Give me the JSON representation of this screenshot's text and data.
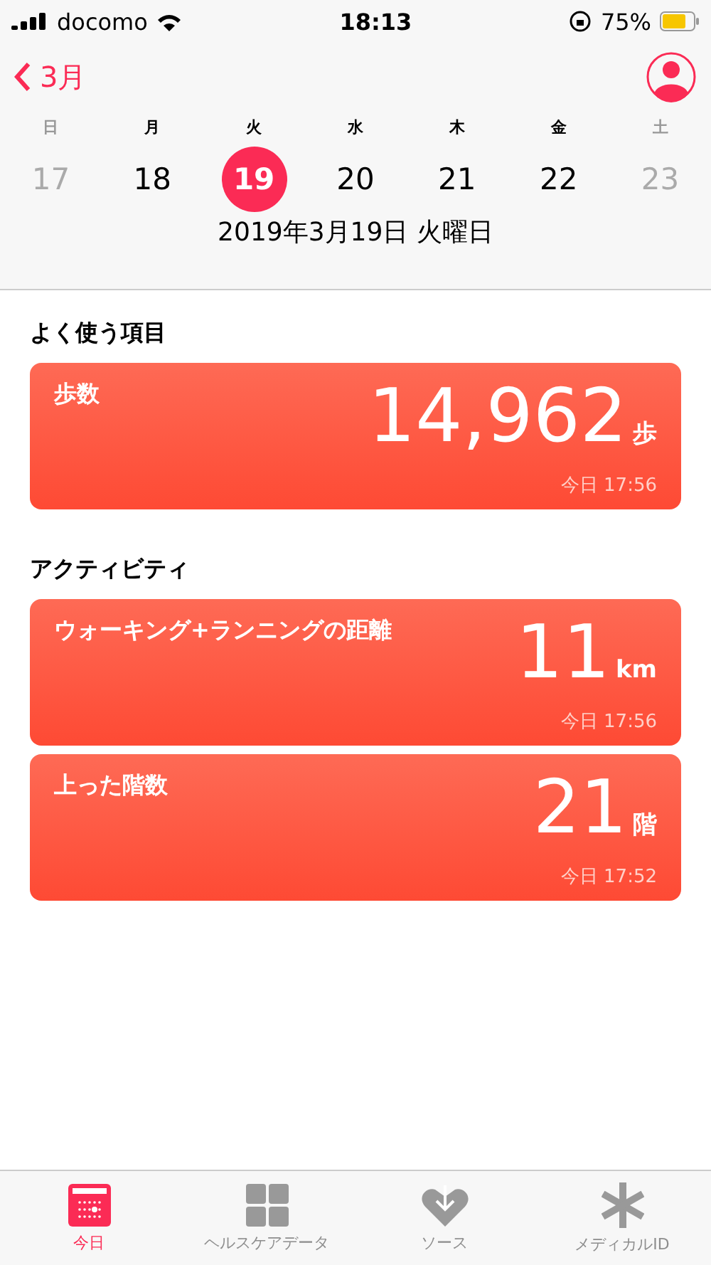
{
  "status_bar": {
    "carrier": "docomo",
    "time": "18:13",
    "battery": "75%"
  },
  "nav": {
    "back": "3月"
  },
  "week": [
    {
      "weekday": "日",
      "date": "17",
      "muted": true,
      "selected": false
    },
    {
      "weekday": "月",
      "date": "18",
      "muted": false,
      "selected": false
    },
    {
      "weekday": "火",
      "date": "19",
      "muted": false,
      "selected": true
    },
    {
      "weekday": "水",
      "date": "20",
      "muted": false,
      "selected": false
    },
    {
      "weekday": "木",
      "date": "21",
      "muted": false,
      "selected": false
    },
    {
      "weekday": "金",
      "date": "22",
      "muted": false,
      "selected": false
    },
    {
      "weekday": "土",
      "date": "23",
      "muted": true,
      "selected": false
    }
  ],
  "date_title": "2019年3月19日 火曜日",
  "sections": [
    {
      "heading": "よく使う項目",
      "cards": [
        {
          "title": "歩数",
          "value": "14,962",
          "unit": "歩",
          "time": "今日 17:56"
        }
      ]
    },
    {
      "heading": "アクティビティ",
      "cards": [
        {
          "title": "ウォーキング+ランニングの距離",
          "value": "11",
          "unit": "km",
          "time": "今日 17:56"
        },
        {
          "title": "上った階数",
          "value": "21",
          "unit": "階",
          "time": "今日 17:52"
        }
      ]
    }
  ],
  "tabs": [
    {
      "kind": "today",
      "label": "今日",
      "selected": true
    },
    {
      "kind": "data",
      "label": "ヘルスケアデータ",
      "selected": false
    },
    {
      "kind": "sources",
      "label": "ソース",
      "selected": false
    },
    {
      "kind": "medical",
      "label": "メディカルID",
      "selected": false
    }
  ]
}
